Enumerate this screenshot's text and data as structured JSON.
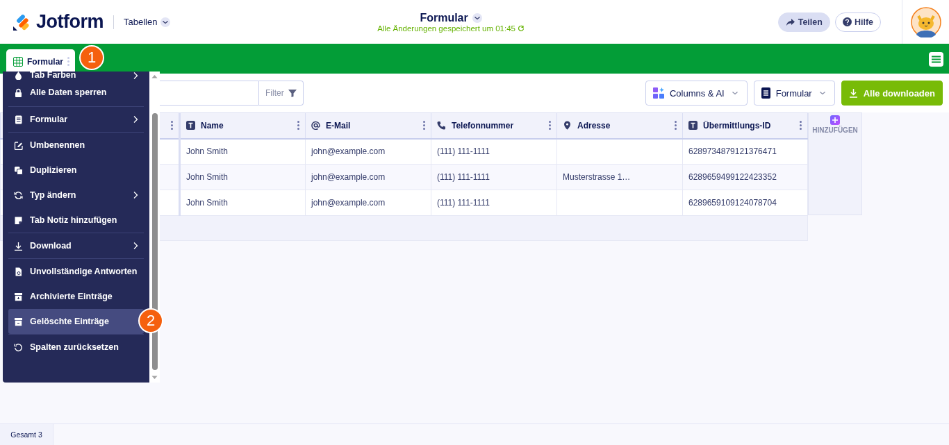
{
  "header": {
    "logo": "Jotform",
    "section": "Tabellen",
    "title": "Formular",
    "save_status": "Alle Änderungen gespeichert um 01:45",
    "buttons": [
      {
        "label": "Teilen",
        "kind": "share"
      },
      {
        "label": "Hilfe",
        "kind": "help"
      }
    ]
  },
  "tabs": [
    {
      "label": "Formular",
      "selected": true
    }
  ],
  "markers": [
    "1",
    "2"
  ],
  "toolbar": {
    "filter": "Filter",
    "buttons": [
      {
        "label": "Columns & AI",
        "kind": "columns"
      },
      {
        "label": "Formular",
        "kind": "form"
      },
      {
        "label": "Alle downloaden",
        "kind": "download"
      }
    ]
  },
  "menu": {
    "sections": [
      [
        {
          "label": "Tab Farben",
          "submenu": true,
          "selected": false
        },
        {
          "label": "Alle Daten sperren",
          "submenu": false,
          "selected": false
        }
      ],
      [
        {
          "label": "Formular",
          "submenu": true,
          "selected": false
        }
      ],
      [
        {
          "label": "Umbenennen",
          "submenu": false,
          "selected": false
        },
        {
          "label": "Duplizieren",
          "submenu": false,
          "selected": false
        },
        {
          "label": "Typ ändern",
          "submenu": true,
          "selected": false
        },
        {
          "label": "Tab Notiz hinzufügen",
          "submenu": false,
          "selected": false
        }
      ],
      [
        {
          "label": "Download",
          "submenu": true,
          "selected": false
        }
      ],
      [
        {
          "label": "Unvollständige Antworten",
          "submenu": false,
          "selected": false
        },
        {
          "label": "Archivierte Einträge",
          "submenu": false,
          "selected": false
        },
        {
          "label": "Gelöschte Einträge",
          "submenu": false,
          "selected": true
        }
      ],
      [
        {
          "label": "Spalten zurücksetzen",
          "submenu": false,
          "selected": false
        }
      ]
    ]
  },
  "table": {
    "columns": [
      {
        "kind": "hidden"
      },
      {
        "label": "Name",
        "kind": "text"
      },
      {
        "label": "E-Mail",
        "kind": "email"
      },
      {
        "label": "Telefonnummer",
        "kind": "phone"
      },
      {
        "label": "Adresse",
        "kind": "address"
      },
      {
        "label": "Übermittlungs-ID",
        "kind": "text"
      }
    ],
    "add_column": "HINZUFÜGEN",
    "rows": [
      [
        "",
        "John Smith",
        "john@example.com",
        "(111) 111-1111",
        "",
        "6289734879121376471"
      ],
      [
        "",
        "John Smith",
        "john@example.com",
        "(111) 111-1111",
        "Musterstrasse 1…",
        "6289659499122423352"
      ],
      [
        "",
        "John Smith",
        "john@example.com",
        "(111) 111-1111",
        "",
        "6289659109124078704"
      ]
    ]
  },
  "status_bar": {
    "total": "Gesamt 3"
  }
}
